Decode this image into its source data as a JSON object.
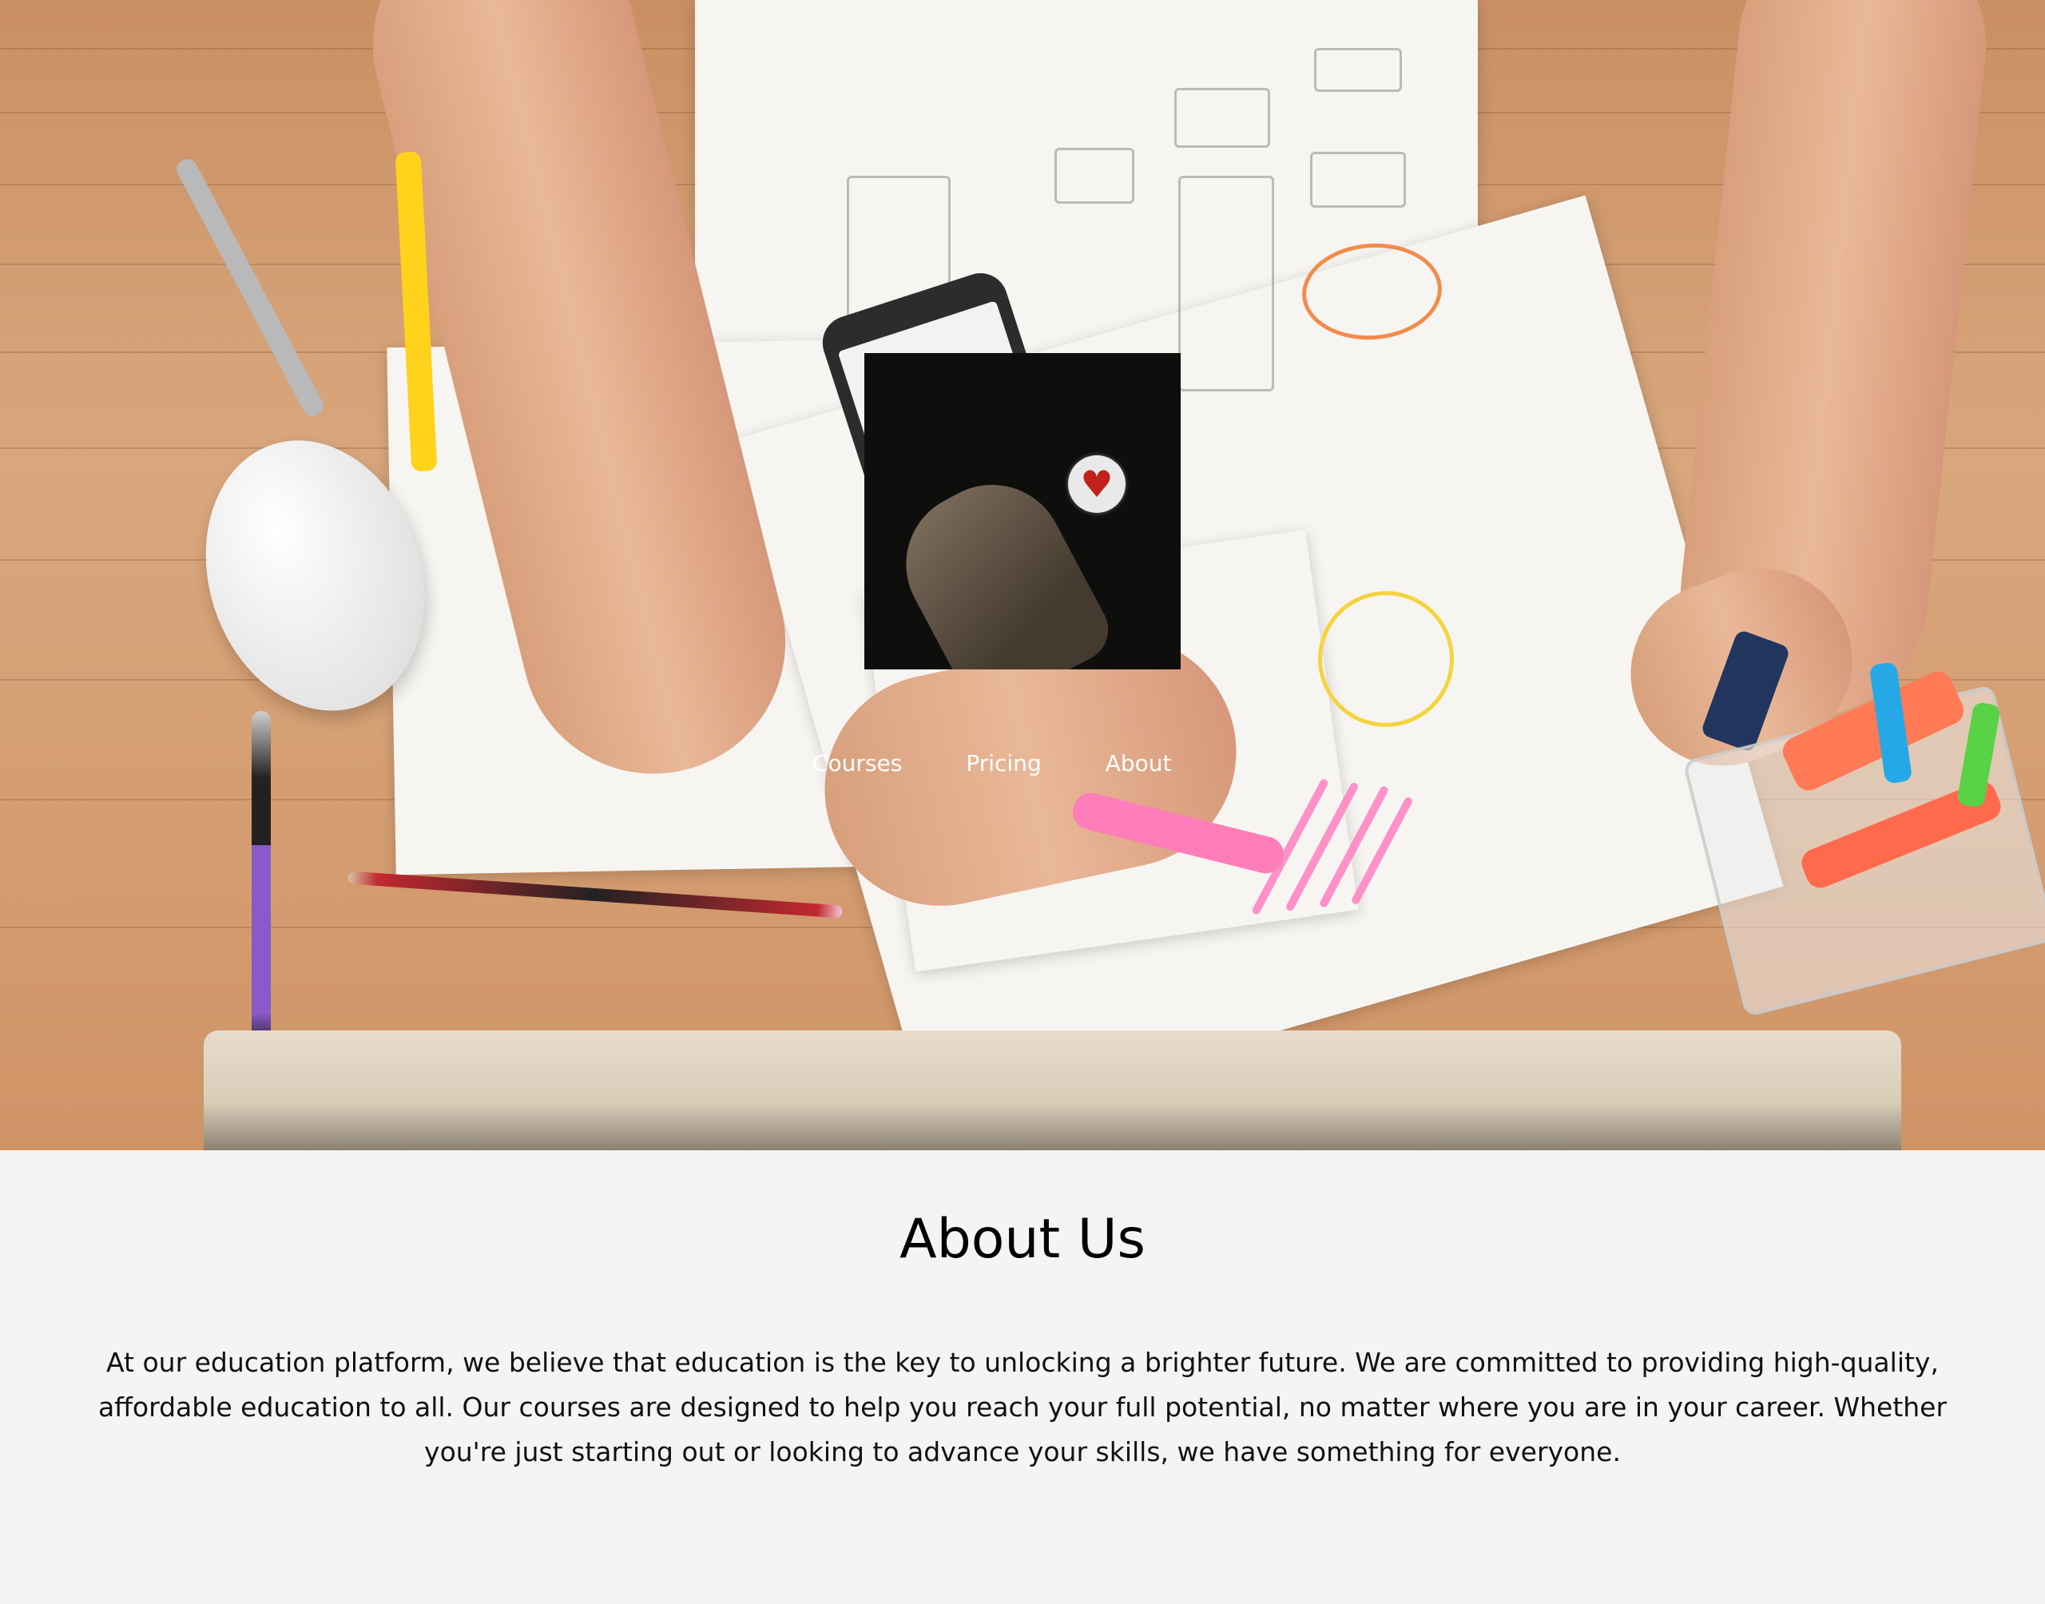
{
  "hero": {
    "background_image": "workspace-desk-photo",
    "logo": {
      "image": "hand-holding-heart-badge"
    }
  },
  "nav": {
    "items": [
      {
        "label": "Courses"
      },
      {
        "label": "Pricing"
      },
      {
        "label": "About"
      }
    ]
  },
  "about": {
    "title": "About Us",
    "body": "At our education platform, we believe that education is the key to unlocking a brighter future. We are committed to providing high-quality, affordable education to all. Our courses are designed to help you reach your full potential, no matter where you are in your career. Whether you're just starting out or looking to advance your skills, we have something for everyone."
  },
  "colors": {
    "page_background": "#f3f4f6",
    "nav_text": "#ffffff",
    "heading_text": "#000000",
    "body_text": "#111111",
    "logo_background": "#0e0f0c",
    "heart": "#c0211b"
  }
}
